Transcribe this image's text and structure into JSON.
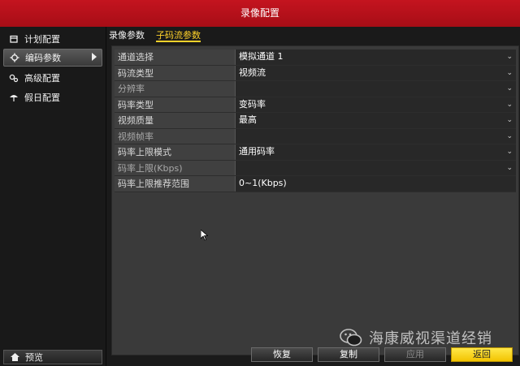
{
  "window": {
    "title": "录像配置"
  },
  "sidebar": {
    "items": [
      {
        "label": "计划配置",
        "icon": "calendar-icon"
      },
      {
        "label": "编码参数",
        "icon": "gear-icon",
        "active": true
      },
      {
        "label": "高级配置",
        "icon": "advanced-settings-icon"
      },
      {
        "label": "假日配置",
        "icon": "umbrella-icon"
      }
    ],
    "preview_label": "预览"
  },
  "tabs": [
    {
      "label": "录像参数",
      "active": false
    },
    {
      "label": "子码流参数",
      "active": true
    }
  ],
  "form": {
    "rows": [
      {
        "label": "通道选择",
        "value": "模拟通道 1",
        "dropdown": true
      },
      {
        "label": "码流类型",
        "value": "视频流",
        "dropdown": true
      },
      {
        "label": "分辨率",
        "value": "",
        "dropdown": true
      },
      {
        "label": "码率类型",
        "value": "变码率",
        "dropdown": true
      },
      {
        "label": "视频质量",
        "value": "最高",
        "dropdown": true
      },
      {
        "label": "视频帧率",
        "value": "",
        "dropdown": true
      },
      {
        "label": "码率上限模式",
        "value": "通用码率",
        "dropdown": true
      },
      {
        "label": "码率上限(Kbps)",
        "value": "",
        "dropdown": true
      },
      {
        "label": "码率上限推荐范围",
        "value": "0~1(Kbps)",
        "dropdown": false
      }
    ]
  },
  "buttons": {
    "restore": "恢复",
    "copy": "复制",
    "apply": "应用",
    "back": "返回"
  },
  "watermark": {
    "text": "海康威视渠道经销",
    "icon": "wechat-icon"
  },
  "colors": {
    "title_bar": "#b5101a",
    "active_tab": "#ffd22a",
    "primary_button": "#f5cc00"
  }
}
